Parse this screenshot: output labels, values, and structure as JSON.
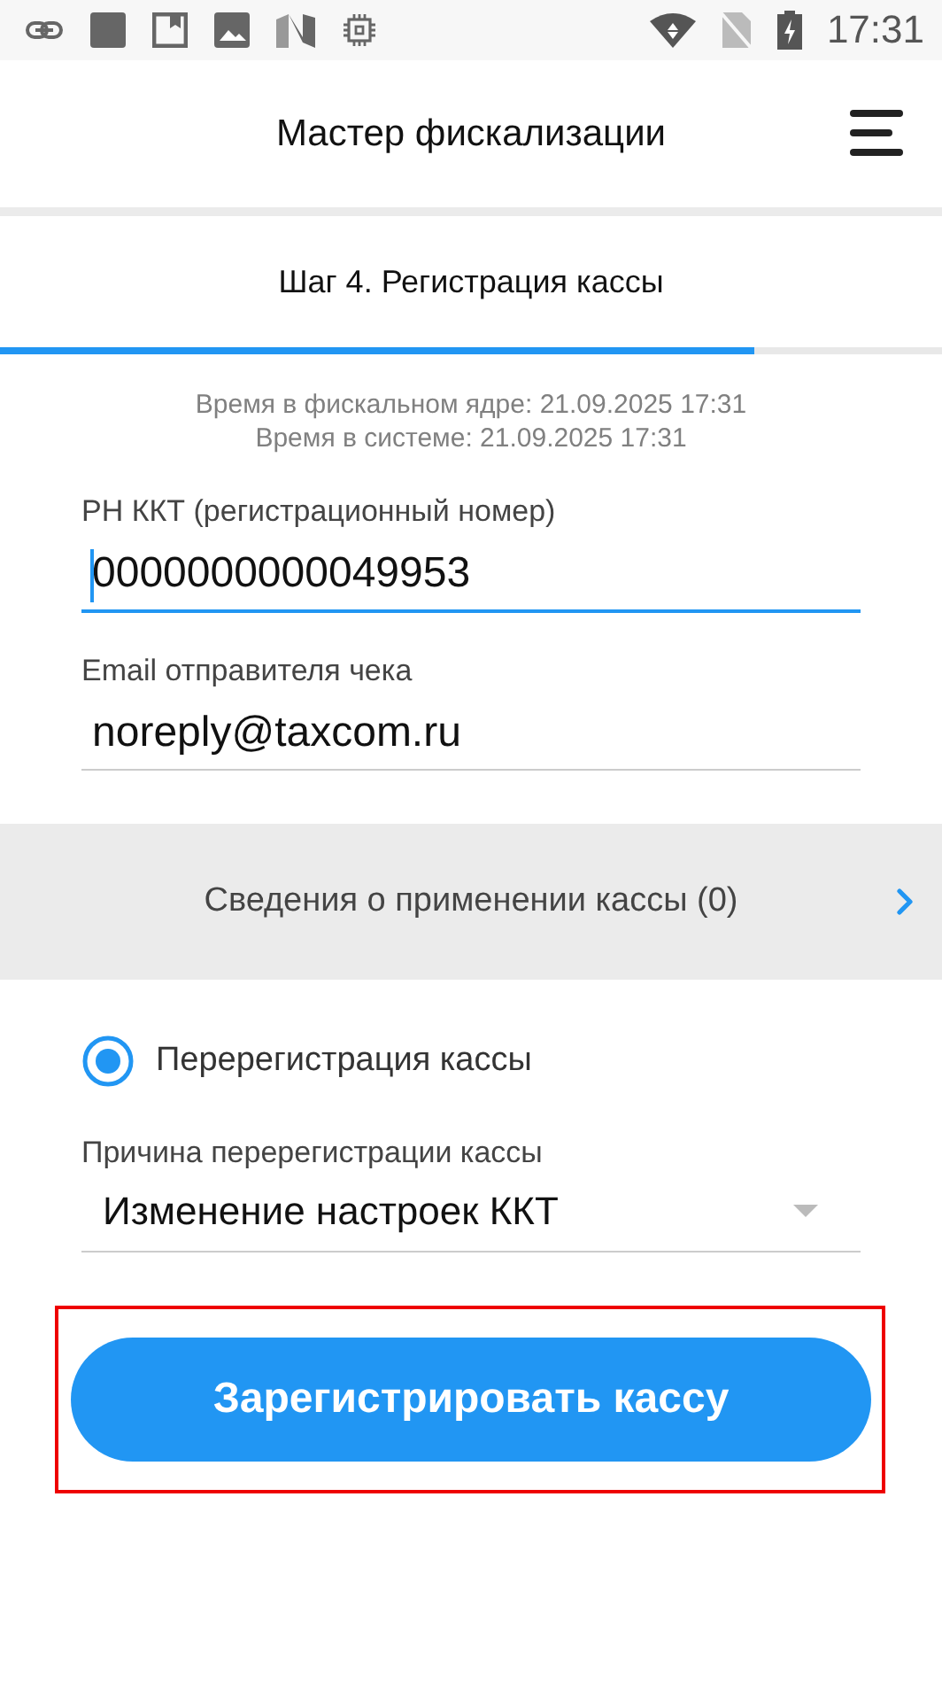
{
  "status_bar": {
    "time": "17:31"
  },
  "header": {
    "title": "Мастер фискализации"
  },
  "step": {
    "title": "Шаг 4. Регистрация кассы",
    "level": 0.8
  },
  "times": [
    "Время в фискальном ядре: 21.09.2025 17:31",
    "Время в системе: 21.09.2025 17:31"
  ],
  "fields": [
    {
      "label": "РН ККТ (регистрационный номер)",
      "value": "0000000000049953",
      "focused": true
    },
    {
      "label": "Email отправителя чека",
      "value": "noreply@taxcom.ru",
      "focused": false
    }
  ],
  "info_row": {
    "label": "Сведения о применении кассы (0)"
  },
  "radio": {
    "label": "Перерегистрация кассы",
    "selected": true
  },
  "reason": {
    "label": "Причина перерегистрации кассы",
    "value": "Изменение настроек ККТ"
  },
  "button": {
    "label": "Зарегистрировать кассу",
    "highlighted": true
  }
}
